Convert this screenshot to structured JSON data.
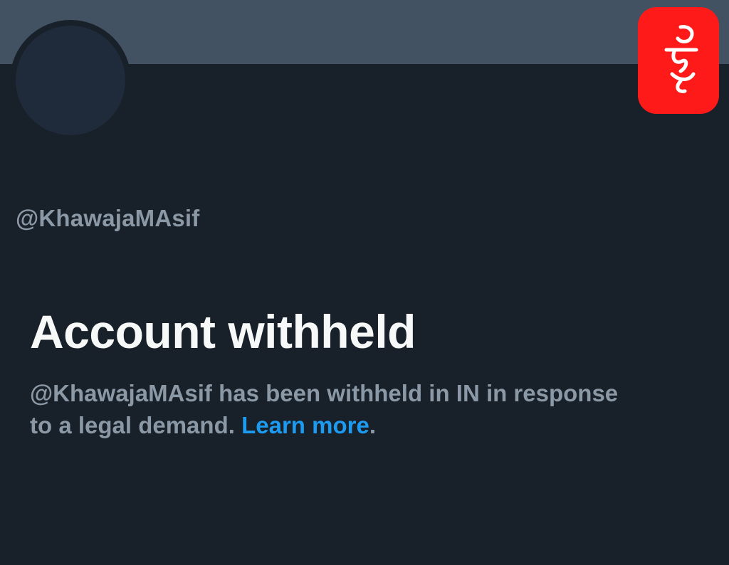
{
  "profile": {
    "handle": "@KhawajaMAsif"
  },
  "notice": {
    "title": "Account withheld",
    "message_line1": "@KhawajaMAsif has been withheld in IN in response",
    "message_line2": "to a legal demand.",
    "learn_more_label": "Learn more",
    "trailing_period": "."
  },
  "watermark": {
    "icon": "red-app-logo-icon",
    "color": "#ff1a1a"
  },
  "colors": {
    "background": "#182029",
    "banner": "#435262",
    "title_text": "#f7f9f9",
    "secondary_text": "#8b98a5",
    "link": "#1d9bf0"
  }
}
